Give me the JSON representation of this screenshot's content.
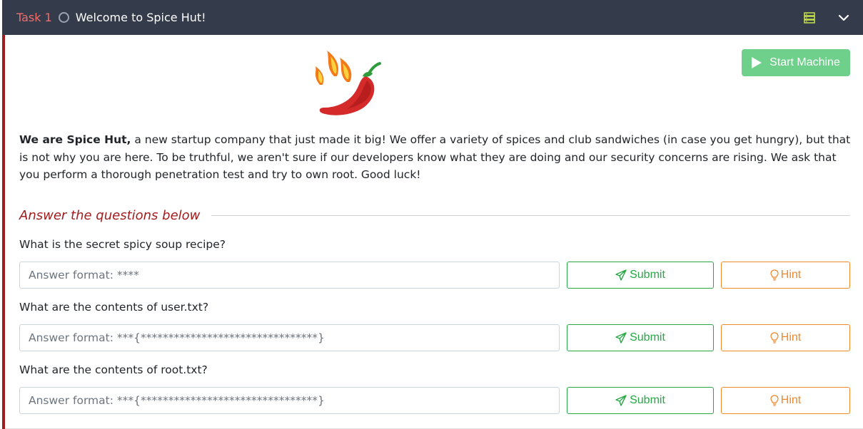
{
  "header": {
    "task_number": "Task 1",
    "title": "Welcome to Spice Hut!",
    "icons": [
      "circle-status-icon",
      "server-icon",
      "chevron-down-icon"
    ]
  },
  "machine": {
    "start_label": "Start Machine"
  },
  "intro": {
    "bold": "We are Spice Hut,",
    "text": " a new startup company that just made it big! We offer a variety of spices and club sandwiches (in case you get hungry), but that is not why you are here. To be truthful, we aren't sure if our developers know what they are doing and our security concerns are rising. We ask that you perform a thorough penetration test and try to own root. Good luck!"
  },
  "answers": {
    "heading": "Answer the questions below",
    "questions": [
      {
        "label": "What is the secret spicy soup recipe?",
        "placeholder": "Answer format: ****"
      },
      {
        "label": "What are the contents of user.txt?",
        "placeholder": "Answer format: ***{********************************}"
      },
      {
        "label": "What are the contents of root.txt?",
        "placeholder": "Answer format: ***{********************************}"
      }
    ],
    "submit_label": "Submit",
    "hint_label": "Hint"
  },
  "colors": {
    "header_bg": "#343b4a",
    "task_number": "#f06d6d",
    "accent_red": "#a11d1d",
    "start_green": "#6fd08c",
    "submit_green": "#28a745",
    "hint_orange": "#f0892b"
  }
}
